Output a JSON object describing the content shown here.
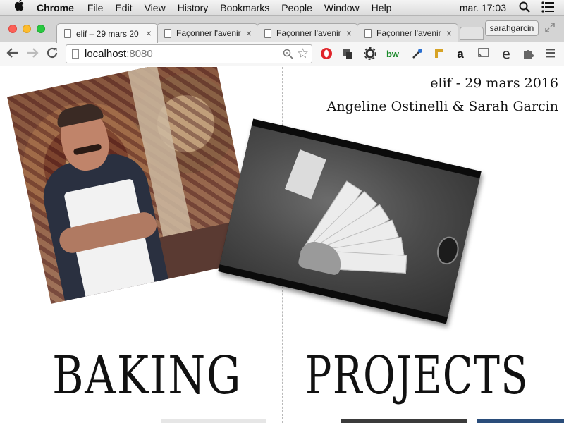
{
  "menubar": {
    "app_name": "Chrome",
    "items": [
      "File",
      "Edit",
      "View",
      "History",
      "Bookmarks",
      "People",
      "Window",
      "Help"
    ],
    "clock": "mar. 17:03",
    "icons": [
      "apple-icon",
      "spotlight-icon",
      "notification-center-icon"
    ]
  },
  "tabs": [
    {
      "title": "elif – 29 mars 20",
      "active": true
    },
    {
      "title": "Façonner l'avenir",
      "active": false
    },
    {
      "title": "Façonner l'avenir",
      "active": false
    },
    {
      "title": "Façonner l'avenir",
      "active": false
    }
  ],
  "profile_label": "sarahgarcin",
  "omnibox": {
    "host": "localhost",
    "port": ":8080"
  },
  "extensions": [
    "opera-icon",
    "stamp-icon",
    "gear-icon",
    "bw-icon",
    "eyedropper-icon",
    "ruler-icon",
    "amazon-icon",
    "cast-icon",
    "e-icon",
    "puzzle-icon",
    "menu-icon"
  ],
  "header": {
    "line1": "elif - 29 mars 2016",
    "line2": "Angeline Ostinelli & Sarah Garcin"
  },
  "headlines": {
    "left": "BAKING",
    "right": "PROJECTS"
  },
  "colors": {
    "menubar_bg": "#e8e8e8",
    "tabstrip_bg": "#d4d4d4",
    "close_red": "#fc5f57",
    "minimize_yellow": "#fdbc2e",
    "zoom_green": "#28c840"
  }
}
